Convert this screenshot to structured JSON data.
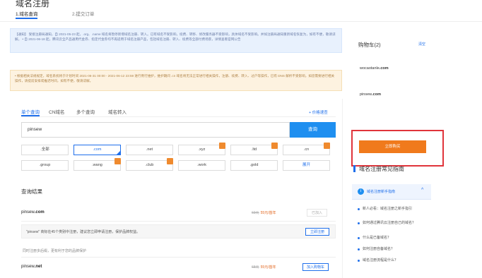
{
  "header": {
    "title": "域名注册",
    "steps": [
      {
        "label": "1.域名查询",
        "active": true
      },
      {
        "label": "2.提交订单",
        "active": false
      }
    ]
  },
  "notices": {
    "blue": "【通知】 受接注册局通知，自 2021-05-23 起，.org、.name 域名将暂停新增域名注册、转入。已有域名不受影响，续费、转移、修改服务器不受影响，具体域名不受影响。并如注册局通知重新域名恢复为，如有不便，敬请谅解。 • 自 2021-06-18 起，腾讯云全产品通用代金券、指定代金券均不再适用于域名注册产品，包括域名注册、转入、续费等全部付费场景，详情查看官网公告",
    "orange": "• 根据相关法规规定，域名系统将于计划时间 2021-06-31 00:00 - 2021-06-12 23:59 进行例行维护，维护期间 .cn 域名将无法正常进行相关操作，注册、续费、转入、过户等操作，已有 DNS 解析不受影响，如您需要进行相关操作，请提前安排或推迟时间，如有不便，敬请谅解。"
  },
  "search": {
    "tabs": [
      "单个查询",
      "CN域名",
      "多个查询",
      "域名转入"
    ],
    "active_tab": 0,
    "bulk_link": "+ 价格速查",
    "input_value": "pinsew",
    "button_label": "查询"
  },
  "tlds": {
    "row1": [
      ".全部",
      ".com",
      ".net",
      ".xyz",
      ".ltd",
      ".cn"
    ],
    "row2": [
      ".group",
      ".wang",
      ".club",
      ".work",
      ".gold",
      "展开"
    ]
  },
  "results": {
    "title": "查询结果",
    "rows": [
      {
        "name": "pinsew",
        "suffix": ".com",
        "old_price": "69元",
        "new_price": "55元/首年",
        "status": "已加入"
      },
      {
        "name": "pinsew",
        "suffix": ".net",
        "old_price": "68元",
        "new_price": "55元/首年",
        "status": "加入购物车"
      }
    ],
    "protect_text": "\"pinsew\" 商标在45个类别中注册，建议您立即申请注册，保护品牌权益。",
    "protect_button": "立即注册",
    "hint": "同时注册多后缀，更有利于您的品牌保护"
  },
  "cart": {
    "title": "购物车(2)",
    "clear_label": "清空",
    "items": [
      {
        "name": "wocaotanle",
        "suffix": ".com"
      },
      {
        "name": "pinsew",
        "suffix": ".com"
      }
    ],
    "buy_label": "立即购买"
  },
  "guide": {
    "title": "域名注册常见指南",
    "head_label": "域名注册新手指南",
    "items": [
      "新人必看：域名注册之新手指引",
      "如何通过腾讯云注册自己的域名？",
      "什么是已备域名？",
      "如何注册自备域名？",
      "域名注册流程是什么？"
    ]
  },
  "colors": {
    "accent": "#1f6feb",
    "button_blue": "#1f8ff0",
    "buy_orange": "#f07a1c",
    "highlight_red": "#e0343b"
  }
}
